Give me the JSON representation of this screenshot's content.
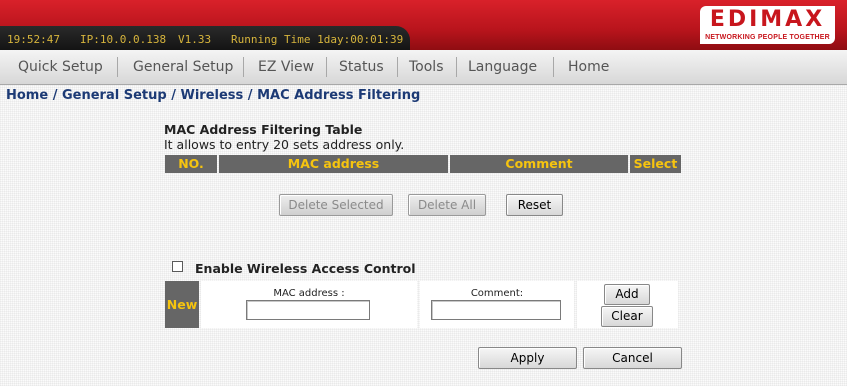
{
  "status_bar": {
    "time": "19:52:47",
    "ip": "IP:10.0.0.138",
    "version": "V1.33",
    "running_time": "Running Time 1day:00:01:39"
  },
  "logo": {
    "brand": "EDIMAX",
    "tagline": "NETWORKING PEOPLE TOGETHER"
  },
  "nav": {
    "items": [
      "Quick Setup",
      "General Setup",
      "EZ View",
      "Status",
      "Tools",
      "Language",
      "Home"
    ]
  },
  "breadcrumb": {
    "items": [
      "Home",
      "General Setup",
      "Wireless",
      "MAC Address Filtering"
    ],
    "separator": " / "
  },
  "filter_table": {
    "title": "MAC Address Filtering Table",
    "note": "It allows to entry 20 sets address only.",
    "columns": [
      "NO.",
      "MAC address",
      "Comment",
      "Select"
    ],
    "rows": [],
    "buttons": {
      "delete_selected": "Delete Selected",
      "delete_all": "Delete All",
      "reset": "Reset"
    }
  },
  "access_control": {
    "enable_label": "Enable Wireless Access Control",
    "enabled": false,
    "new_label": "New",
    "mac_label": "MAC address :",
    "mac_value": "",
    "comment_label": "Comment:",
    "comment_value": "",
    "add_button": "Add",
    "clear_button": "Clear"
  },
  "footer": {
    "apply_button": "Apply",
    "cancel_button": "Cancel"
  },
  "colors": {
    "header_red": "#c8161d",
    "status_text": "#d6b43c",
    "table_header_bg": "#666666",
    "table_header_text": "#f6c40f",
    "breadcrumb_text": "#1c3a75"
  }
}
